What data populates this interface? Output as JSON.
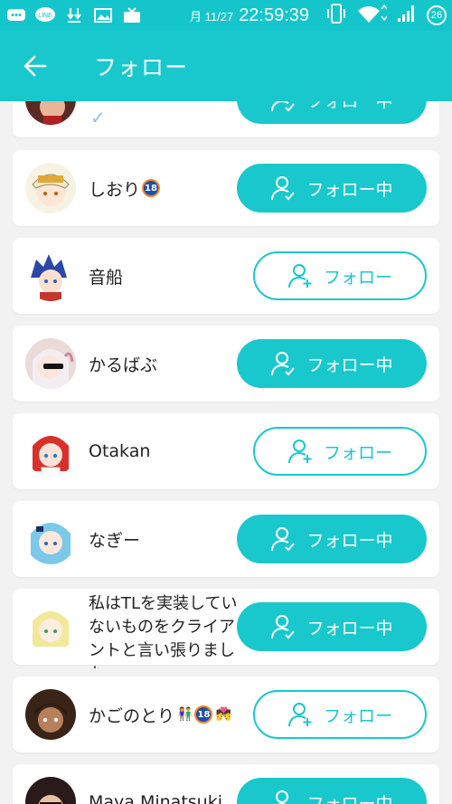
{
  "status_bar": {
    "date": "月 11/27",
    "time": "22:59:39",
    "battery": "26",
    "icons": [
      "chat-icon",
      "line-icon",
      "download-icon",
      "image-icon",
      "tv-icon",
      "vibrate-icon",
      "wifi-icon",
      "signal-icon"
    ],
    "line_label": "LINE"
  },
  "app_bar": {
    "title": "フォロー",
    "back_icon": "arrow-left-icon"
  },
  "colors": {
    "accent": "#19c8cc",
    "badge_blue": "#1d4fa8",
    "badge_orange": "#f0862a"
  },
  "users": [
    {
      "name": "",
      "button": "フォロー中",
      "state": "following",
      "verified": true
    },
    {
      "name": "しおり",
      "badge": "18",
      "button": "フォロー中",
      "state": "following"
    },
    {
      "name": "音船",
      "button": "フォロー",
      "state": "follow"
    },
    {
      "name": "かるばぶ",
      "button": "フォロー中",
      "state": "following"
    },
    {
      "name": "Otakan",
      "button": "フォロー",
      "state": "follow"
    },
    {
      "name": "なぎー",
      "button": "フォロー中",
      "state": "following"
    },
    {
      "name": "私はTLを実装していないものをクライアントと言い張りました",
      "button": "フォロー中",
      "state": "following"
    },
    {
      "name": "かごのとり",
      "badge": "18",
      "button": "フォロー",
      "state": "follow"
    },
    {
      "name": "Maya Minatsuki",
      "button": "フォロー中",
      "state": "following"
    }
  ]
}
